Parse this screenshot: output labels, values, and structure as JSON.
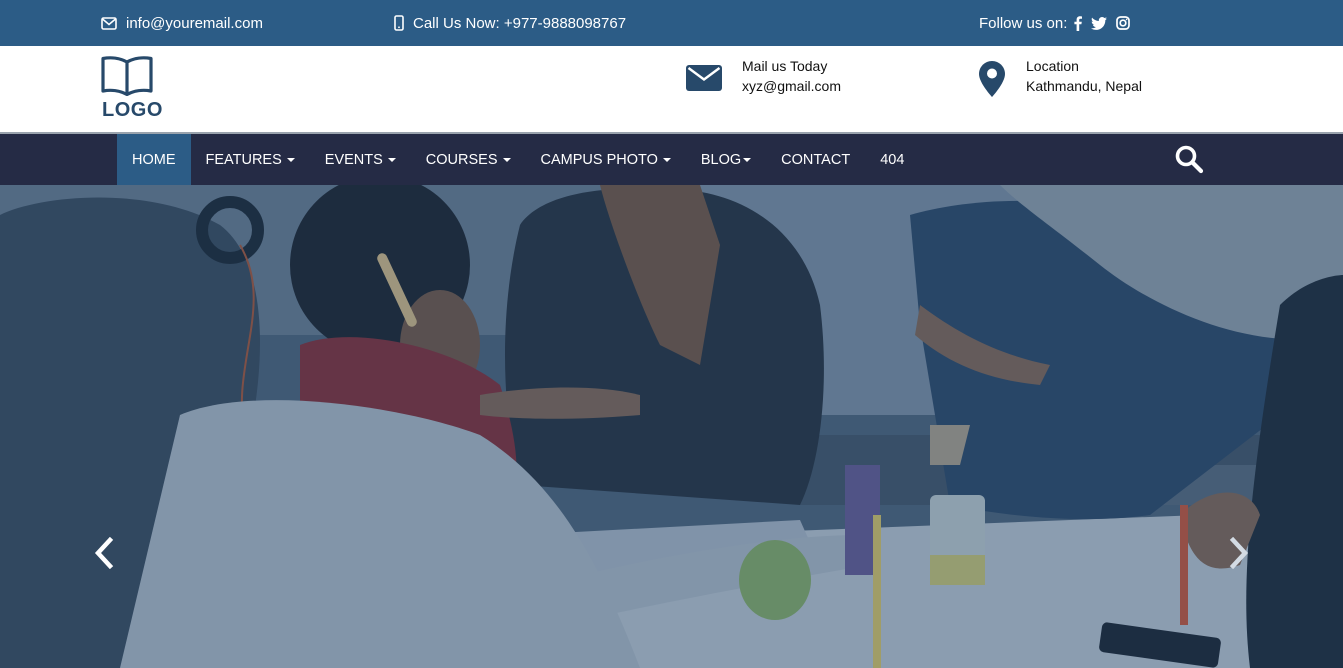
{
  "topbar": {
    "email": "info@youremail.com",
    "phone": "Call Us Now: +977-9888098767",
    "follow_label": "Follow us on:",
    "social": [
      "facebook-icon",
      "twitter-icon",
      "instagram-icon"
    ],
    "bg_color": "#2c5c86"
  },
  "header": {
    "logo_text": "LOGO",
    "mail_title": "Mail us Today",
    "mail_value": "xyz@gmail.com",
    "location_title": "Location",
    "location_value": "Kathmandu, Nepal",
    "accent_color": "#27496a"
  },
  "nav": {
    "items": [
      {
        "label": "HOME",
        "active": true,
        "dropdown": false
      },
      {
        "label": "FEATURES",
        "active": false,
        "dropdown": true
      },
      {
        "label": "EVENTS",
        "active": false,
        "dropdown": true
      },
      {
        "label": "COURSES",
        "active": false,
        "dropdown": true
      },
      {
        "label": "CAMPUS PHOTO",
        "active": false,
        "dropdown": true
      },
      {
        "label": "BLOG",
        "active": false,
        "dropdown": true
      },
      {
        "label": "CONTACT",
        "active": false,
        "dropdown": false
      },
      {
        "label": "404",
        "active": false,
        "dropdown": false
      }
    ],
    "bg_color": "#252b45",
    "active_color": "#2c5c86"
  },
  "hero": {
    "prev_icon": "chevron-left-icon",
    "next_icon": "chevron-right-icon"
  }
}
